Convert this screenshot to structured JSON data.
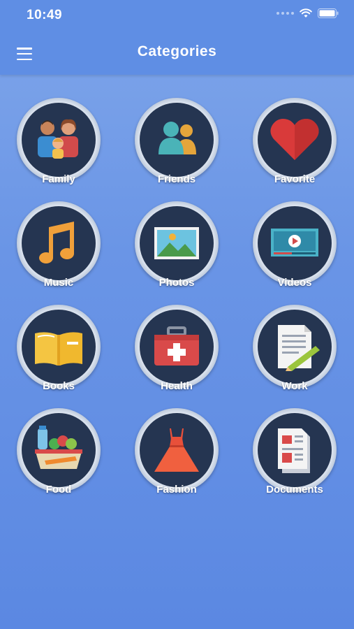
{
  "status_bar": {
    "time": "10:49"
  },
  "header": {
    "title": "Categories"
  },
  "categories": [
    {
      "label": "Family",
      "icon": "family-icon"
    },
    {
      "label": "Friends",
      "icon": "friends-icon"
    },
    {
      "label": "Favorite",
      "icon": "heart-icon"
    },
    {
      "label": "Music",
      "icon": "music-note-icon"
    },
    {
      "label": "Photos",
      "icon": "photo-icon"
    },
    {
      "label": "Videos",
      "icon": "video-icon"
    },
    {
      "label": "Books",
      "icon": "book-icon"
    },
    {
      "label": "Health",
      "icon": "first-aid-kit-icon"
    },
    {
      "label": "Work",
      "icon": "document-pen-icon"
    },
    {
      "label": "Food",
      "icon": "food-basket-icon"
    },
    {
      "label": "Fashion",
      "icon": "dress-icon"
    },
    {
      "label": "Documents",
      "icon": "documents-icon"
    }
  ],
  "colors": {
    "header_bg": "#5f8ee4",
    "icon_circle": "#253551",
    "ring": "#e8eef7",
    "text": "#ffffff"
  }
}
